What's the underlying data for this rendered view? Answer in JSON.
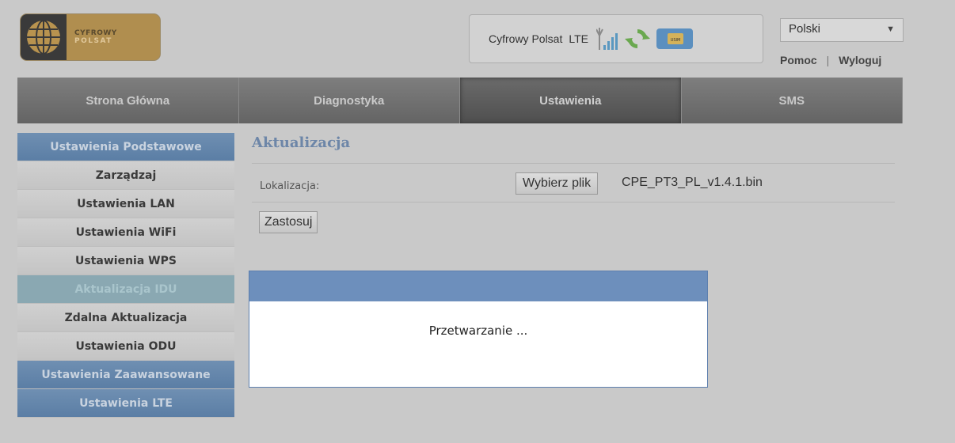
{
  "logo": {
    "line1": "CYFROWY",
    "line2": "POLSAT"
  },
  "status": {
    "operator": "Cyfrowy Polsat",
    "network": "LTE",
    "signal_icon": "signal-antenna-icon",
    "sync_icon": "refresh-icon",
    "sim_icon": "sim-card-icon",
    "sim_label": "USIM"
  },
  "language": {
    "selected": "Polski"
  },
  "header_links": {
    "help": "Pomoc",
    "logout": "Wyloguj"
  },
  "nav": {
    "tabs": [
      {
        "label": "Strona Główna"
      },
      {
        "label": "Diagnostyka"
      },
      {
        "label": "Ustawienia"
      },
      {
        "label": "SMS"
      }
    ],
    "active": "Ustawienia"
  },
  "sidebar": {
    "items": [
      {
        "label": "Ustawienia Podstawowe"
      },
      {
        "label": "Zarządzaj"
      },
      {
        "label": "Ustawienia LAN"
      },
      {
        "label": "Ustawienia WiFi"
      },
      {
        "label": "Ustawienia WPS"
      },
      {
        "label": "Aktualizacja IDU"
      },
      {
        "label": "Zdalna Aktualizacja"
      },
      {
        "label": "Ustawienia ODU"
      },
      {
        "label": "Ustawienia Zaawansowane"
      },
      {
        "label": "Ustawienia LTE"
      }
    ]
  },
  "main": {
    "title": "Aktualizacja",
    "location_label": "Lokalizacja:",
    "file_button": "Wybierz plik",
    "file_name": "CPE_PT3_PL_v1.4.1.bin",
    "apply_button": "Zastosuj"
  },
  "modal": {
    "message": "Przetwarzanie ..."
  },
  "colors": {
    "accent_blue": "#6d8fbc",
    "overlay_bg": "#c9c9c9",
    "title_blue": "#6d86a8"
  }
}
